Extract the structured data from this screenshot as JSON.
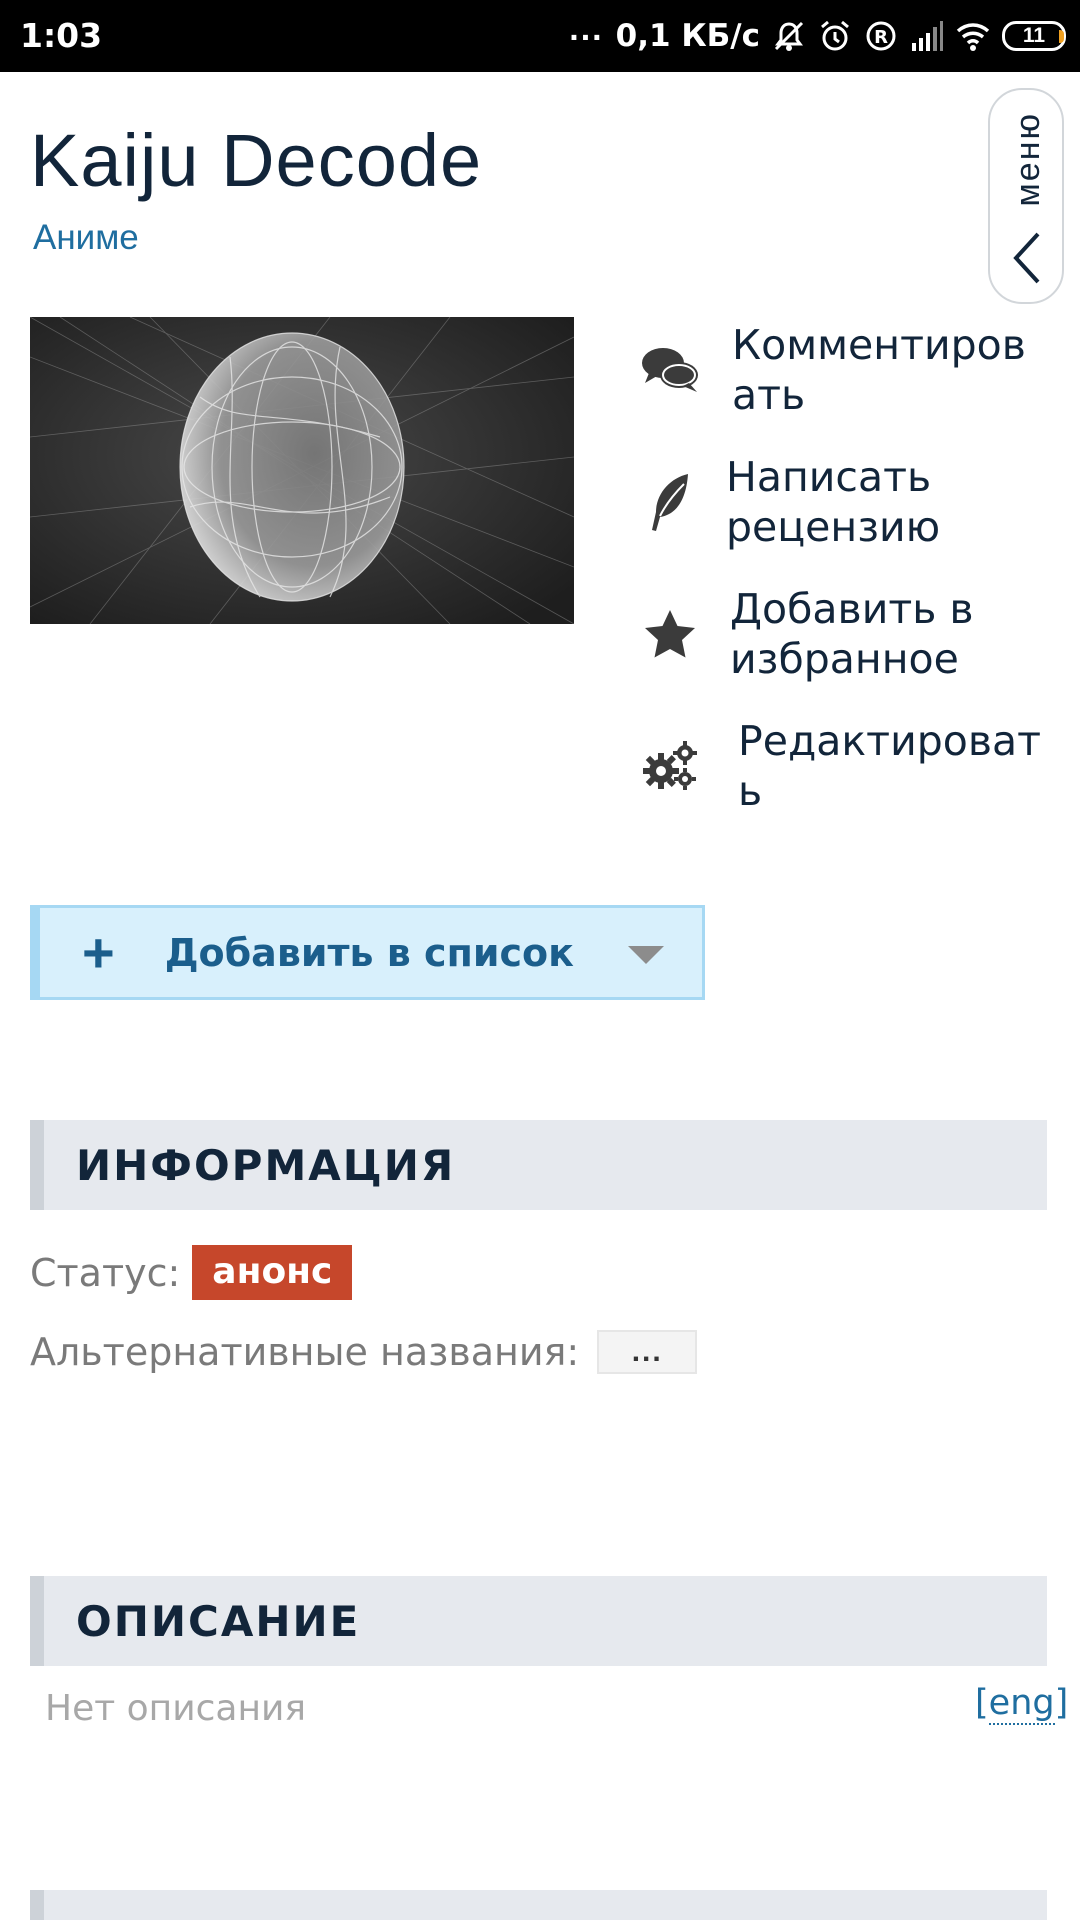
{
  "status_bar": {
    "time": "1:03",
    "dots": "...",
    "speed": "0,1 КБ/с",
    "battery": "11"
  },
  "page": {
    "title": "Kaiju Decode",
    "kind": "Аниме",
    "menu_label": "меню"
  },
  "actions": [
    {
      "label": "Комментиров\nать",
      "icon": "comments-icon"
    },
    {
      "label": "Написать\nрецензию",
      "icon": "feather-icon"
    },
    {
      "label": "Добавить в\nизбранное",
      "icon": "star-icon"
    },
    {
      "label": "Редактироват\nь",
      "icon": "gears-icon"
    }
  ],
  "add_list": {
    "plus": "+",
    "label": "Добавить в список"
  },
  "info": {
    "heading": "ИНФОРМАЦИЯ",
    "status_label": "Статус:",
    "status_value": "анонс",
    "alt_names_label": "Альтернативные названия:",
    "alt_names_more": "..."
  },
  "description": {
    "heading": "ОПИСАНИЕ",
    "empty_text": "Нет описания",
    "lang_open": "[",
    "lang": "eng",
    "lang_close": "]"
  },
  "colors": {
    "status_badge": "#c6472b",
    "link": "#1f6ea0",
    "add_list_bg": "#d8f0fc"
  }
}
